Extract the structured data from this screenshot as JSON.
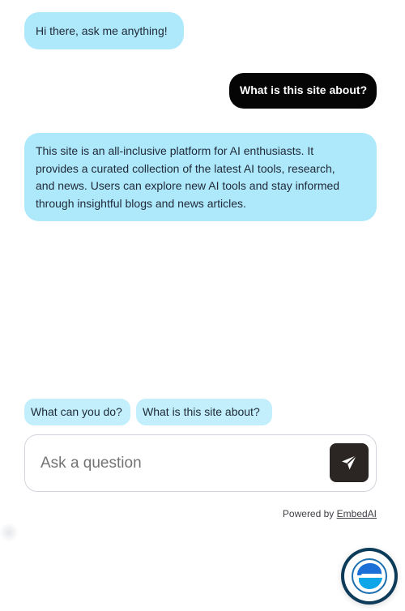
{
  "messages": {
    "greeting": "Hi there, ask me anything!",
    "user_question": "What is this site about?",
    "answer": "This site is an all-inclusive platform for AI enthusiasts. It\nprovides a curated collection of the latest AI tools, research,\nand news. Users can explore new AI tools and stay informed\nthrough insightful blogs and news articles."
  },
  "suggestions": [
    "What can you do?",
    "What is this site about?"
  ],
  "input": {
    "placeholder": "Ask a question",
    "value": ""
  },
  "footer": {
    "powered_by": "Powered by",
    "brand": "EmbedAI"
  },
  "icons": {
    "send": "send-arrow-icon",
    "launcher": "embedai-logo-icon"
  },
  "colors": {
    "bot_bubble": "#aee8fb",
    "user_bubble": "#050505",
    "chip": "#c2effb",
    "send_button": "#2b2524",
    "launcher_ring": "#0d3b5a"
  }
}
